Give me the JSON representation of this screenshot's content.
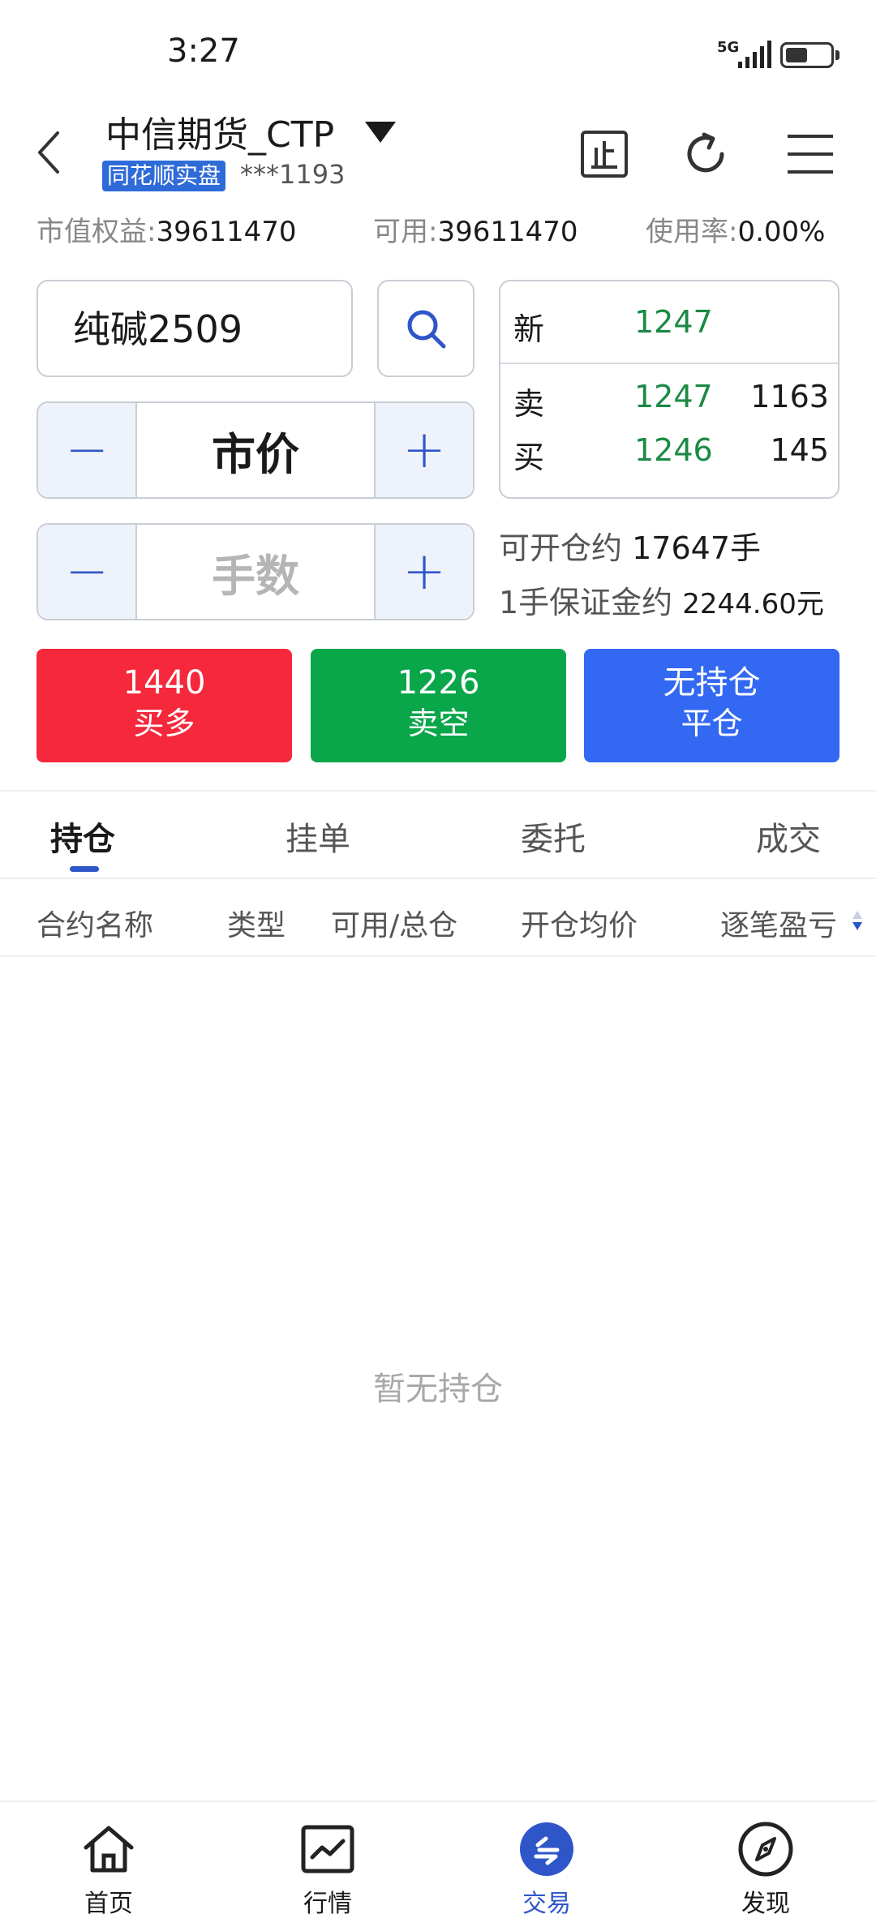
{
  "status_bar": {
    "time": "3:27",
    "network": "5G"
  },
  "header": {
    "broker": "中信期货_CTP",
    "account_badge": "同花顺实盘",
    "account_masked": "***1193"
  },
  "summary": {
    "equity_label": "市值权益:",
    "equity_value": "39611470",
    "available_label": "可用:",
    "available_value": "39611470",
    "usage_label": "使用率:",
    "usage_value": "0.00%"
  },
  "order": {
    "symbol": "纯碱2509",
    "price_mode": "市价",
    "quantity_placeholder": "手数",
    "minus": "−",
    "plus": "+"
  },
  "quote": {
    "last_label": "新",
    "last_price": "1247",
    "ask_label": "卖",
    "ask_price": "1247",
    "ask_volume": "1163",
    "bid_label": "买",
    "bid_price": "1246",
    "bid_volume": "145"
  },
  "info": {
    "open_label": "可开仓约",
    "open_value": "17647手",
    "margin_label": "1手保证金约",
    "margin_value": "2244.60元"
  },
  "actions": {
    "buy_value": "1440",
    "buy_label": "买多",
    "sell_value": "1226",
    "sell_label": "卖空",
    "close_value": "无持仓",
    "close_label": "平仓",
    "colors": {
      "buy": "#f5283c",
      "sell": "#0aa64a",
      "close": "#3368f2"
    }
  },
  "tabs": [
    "持仓",
    "挂单",
    "委托",
    "成交"
  ],
  "columns": [
    "合约名称",
    "类型",
    "可用/总仓",
    "开仓均价",
    "逐笔盈亏"
  ],
  "empty_text": "暂无持仓",
  "nav": [
    {
      "label": "首页",
      "icon": "home-icon"
    },
    {
      "label": "行情",
      "icon": "chart-icon"
    },
    {
      "label": "交易",
      "icon": "trade-icon"
    },
    {
      "label": "发现",
      "icon": "compass-icon"
    }
  ],
  "accent_color": "#2f56c8"
}
